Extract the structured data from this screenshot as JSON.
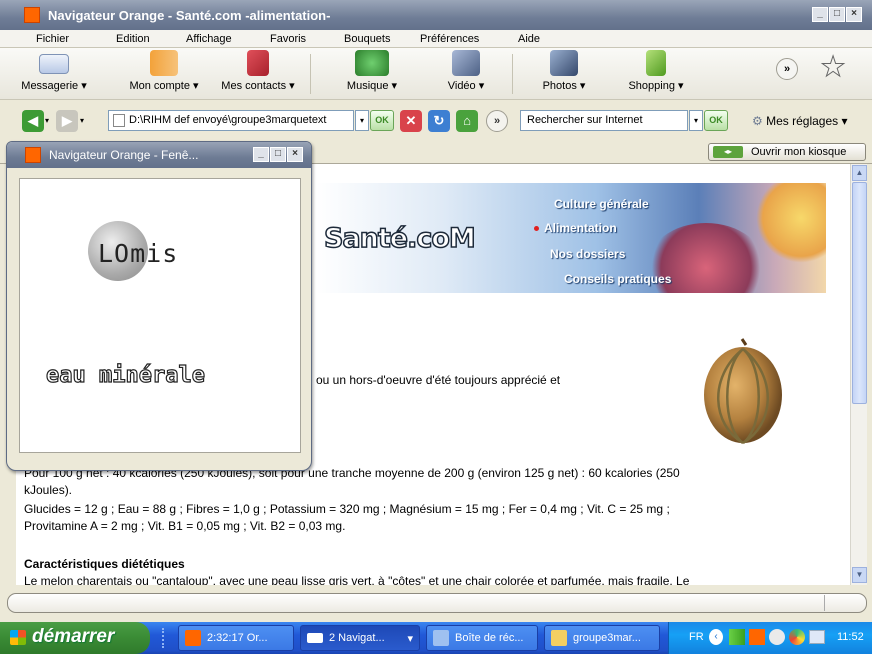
{
  "window": {
    "title": "Navigateur Orange  - Santé.com -alimentation-"
  },
  "menubar": [
    "Fichier",
    "Edition",
    "Affichage",
    "Favoris",
    "Bouquets",
    "Préférences",
    "Aide"
  ],
  "toolbar": {
    "messagerie": "Messagerie",
    "mon_compte": "Mon compte",
    "mes_contacts": "Mes contacts",
    "musique": "Musique",
    "video": "Vidéo",
    "photos": "Photos",
    "shopping": "Shopping",
    "more": "»"
  },
  "nav": {
    "address": "D:\\RIHM def envoyé\\groupe3marquetext",
    "ok": "OK",
    "search_placeholder": "Rechercher sur Internet",
    "settings": "Mes réglages",
    "kiosk": "Ouvrir mon kiosque"
  },
  "banner": {
    "logo": "Santé.coM",
    "menu": [
      "Culture générale",
      "Alimentation",
      "Nos dossiers",
      "Conseils pratiques"
    ]
  },
  "content": {
    "line_intro": "ou un hors-d'oeuvre d'été toujours apprécié et",
    "line_cal_a": "Pour 100 g net : 40 kcalories (250 kJoules), soit pour une tranche moyenne de 200 g (environ 125 g net) : 60 kcalories (250",
    "line_cal_b": "kJoules).",
    "line_nut_a": "Glucides = 12 g ; Eau = 88 g ; Fibres = 1,0 g ; Potassium = 320 mg ; Magnésium = 15 mg ; Fer = 0,4 mg ; Vit. C = 25 mg ;",
    "line_nut_b": "Provitamine A = 2 mg ; Vit. B1 = 0,05 mg ; Vit. B2 = 0,03 mg.",
    "heading": "Caractéristiques diététiques",
    "line_cut": "Le melon charentais ou \"cantaloup\", avec une peau lisse gris vert, à \"côtes\" et une chair colorée et parfumée, mais fragile. Le"
  },
  "popup": {
    "title": "Navigateur Orange  - Fenê...",
    "brand_prefix": "LO",
    "brand_suffix": "mis",
    "tagline": "eau minérale"
  },
  "taskbar": {
    "start": "démarrer",
    "tasks": [
      "2:32:17 Or...",
      "2 Navigat...",
      "Boîte de réc...",
      "groupe3mar..."
    ],
    "lang": "FR",
    "clock": "11:52"
  },
  "colors": {
    "title_bar": "#6f7d96",
    "taskbar": "#2159d8",
    "start": "#3a8b35",
    "orange": "#ff6600"
  }
}
